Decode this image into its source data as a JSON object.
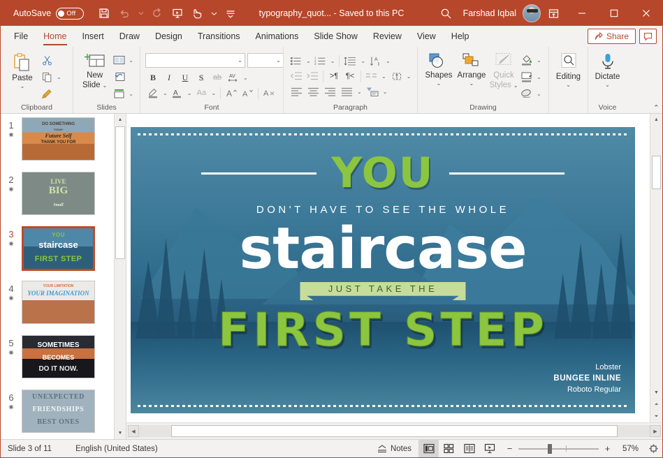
{
  "titlebar": {
    "autosave_label": "AutoSave",
    "autosave_state": "Off",
    "document_title": "typography_quot...  -  Saved to this PC",
    "user_name": "Farshad Iqbal",
    "qat": [
      {
        "name": "save-icon",
        "label": "Save"
      },
      {
        "name": "undo-icon",
        "label": "Undo"
      },
      {
        "name": "redo-icon",
        "label": "Redo"
      },
      {
        "name": "start-presentation-icon",
        "label": "Start From Beginning"
      },
      {
        "name": "touch-mode-icon",
        "label": "Touch/Mouse Mode"
      },
      {
        "name": "customize-qat-icon",
        "label": "Customize Quick Access Toolbar"
      }
    ],
    "window_controls": {
      "minimize": "—",
      "maximize": "☐",
      "close": "✕"
    },
    "ribbon_display_options": "Ribbon Display Options",
    "search": "Search"
  },
  "tabs": [
    {
      "label": "File",
      "active": false
    },
    {
      "label": "Home",
      "active": true
    },
    {
      "label": "Insert",
      "active": false
    },
    {
      "label": "Draw",
      "active": false
    },
    {
      "label": "Design",
      "active": false
    },
    {
      "label": "Transitions",
      "active": false
    },
    {
      "label": "Animations",
      "active": false
    },
    {
      "label": "Slide Show",
      "active": false
    },
    {
      "label": "Review",
      "active": false
    },
    {
      "label": "View",
      "active": false
    },
    {
      "label": "Help",
      "active": false
    }
  ],
  "tab_right": {
    "share_label": "Share",
    "comments_label": "Comments"
  },
  "ribbon": {
    "groups": [
      {
        "name": "Clipboard"
      },
      {
        "name": "Slides"
      },
      {
        "name": "Font"
      },
      {
        "name": "Paragraph"
      },
      {
        "name": "Drawing"
      },
      {
        "name": "Voice"
      }
    ],
    "clipboard": {
      "paste_label": "Paste",
      "cut_label": "Cut",
      "copy_label": "Copy",
      "format_painter_label": "Format Painter"
    },
    "slides": {
      "new_slide_label": "New\nSlide",
      "new_slide_line1": "New",
      "new_slide_line2": "Slide",
      "layout_label": "Layout",
      "reset_label": "Reset",
      "section_label": "Section"
    },
    "font": {
      "font_name_value": "",
      "font_name_placeholder": "",
      "font_size_value": "",
      "bold": "B",
      "italic": "I",
      "underline": "U",
      "shadow": "S",
      "strikethrough": "ab",
      "character_spacing": "AV",
      "text_highlight": "Text Highlight Color",
      "font_color": "Font Color",
      "change_case": "Aa",
      "increase_font_size": "A",
      "decrease_font_size": "A",
      "clear_formatting": "Clear All Formatting"
    },
    "paragraph": {
      "bullets": "Bullets",
      "numbering": "Numbering",
      "line_spacing": "Line Spacing",
      "text_direction": "Text Direction",
      "decrease_indent": "Decrease List Level",
      "increase_indent": "Increase List Level",
      "ltr": "Left-to-Right",
      "rtl": "Right-to-Left",
      "columns": "Columns",
      "align_text": "Align Text",
      "align_left": "Align Left",
      "center": "Center",
      "align_right": "Align Right",
      "justify": "Justify",
      "convert_smartart": "Convert to SmartArt"
    },
    "drawing": {
      "shapes_label": "Shapes",
      "arrange_label": "Arrange",
      "quick_styles_line1": "Quick",
      "quick_styles_line2": "Styles",
      "shape_fill": "Shape Fill",
      "shape_outline": "Shape Outline",
      "shape_effects": "Shape Effects"
    },
    "editing": {
      "editing_label": "Editing"
    },
    "voice": {
      "dictate_label": "Dictate"
    },
    "collapse_ribbon": "Collapse the Ribbon"
  },
  "thumbnails": {
    "selected_index": 3,
    "items": [
      {
        "number": "1",
        "title_lines": [
          "DO SOMETHING",
          "TODAY",
          "Future Self",
          "THANK YOU FOR"
        ],
        "theme": "t1"
      },
      {
        "number": "2",
        "title_lines": [
          "LIVE",
          "BIG",
          "Small"
        ],
        "theme": "t2"
      },
      {
        "number": "3",
        "title_lines": [
          "YOU",
          "staircase",
          "FIRST STEP"
        ],
        "theme": "t3"
      },
      {
        "number": "4",
        "title_lines": [
          "YOUR LIMITATION",
          "YOUR IMAGINATION"
        ],
        "theme": "t4"
      },
      {
        "number": "5",
        "title_lines": [
          "SOMETIMES",
          "BECOMES",
          "DO IT NOW."
        ],
        "theme": "t5"
      },
      {
        "number": "6",
        "title_lines": [
          "UNEXPECTED",
          "FRIENDSHIPS",
          "BEST ONES"
        ],
        "theme": "t6"
      }
    ]
  },
  "slide": {
    "heading_you": "YOU",
    "subline": "DON'T HAVE TO SEE THE WHOLE",
    "word_staircase": "staircase",
    "banner_text": "JUST TAKE THE",
    "headline": "FIRST STEP",
    "credits": [
      "Lobster",
      "BUNGEE INLINE",
      "Roboto Regular"
    ]
  },
  "statusbar": {
    "slide_count": "Slide 3 of 11",
    "language": "English (United States)",
    "notes_label": "Notes",
    "views": [
      {
        "name": "normal-view",
        "label": "Normal",
        "active": true
      },
      {
        "name": "slide-sorter-view",
        "label": "Slide Sorter",
        "active": false
      },
      {
        "name": "reading-view",
        "label": "Reading View",
        "active": false
      },
      {
        "name": "slide-show-view",
        "label": "Slide Show",
        "active": false
      }
    ],
    "zoom_out": "−",
    "zoom_in": "+",
    "zoom_level": "57%",
    "fit_to_window": "Fit slide to current window"
  },
  "colors": {
    "accent": "#b7472a",
    "ribbon_bg": "#f3f2f1",
    "slide_green": "#8cc63e",
    "slide_blue": "#2f6f8f",
    "banner_green": "#c7dc9a"
  }
}
